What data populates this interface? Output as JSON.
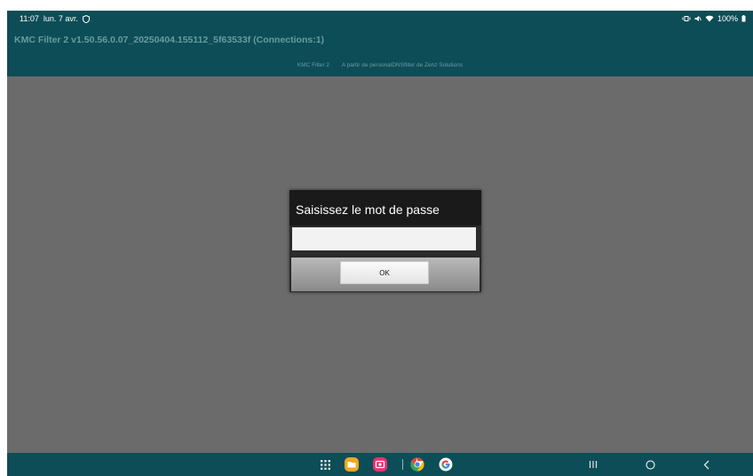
{
  "status_bar": {
    "time": "11:07",
    "date": "lun. 7 avr.",
    "battery": "100%"
  },
  "app_bar": {
    "title": "KMC Filter 2 v1.50.56.0.07_20250404.155112_5f63533f (Connections:1)",
    "subtitle_app": "KMC Filter 2",
    "subtitle_desc": "A partir de personalDNSfilter de Zenz Solutions"
  },
  "dialog": {
    "title": "Saisissez le mot de passe",
    "input_value": "",
    "ok_label": "OK"
  },
  "navbar": {
    "icons": [
      "apps-grid-icon",
      "folder-app-icon",
      "screen-recorder-app-icon",
      "chrome-app-icon",
      "google-app-icon",
      "recents-icon",
      "home-icon",
      "back-icon"
    ]
  },
  "colors": {
    "bar": "#0d4d57",
    "dim_content": "#6b6b6b",
    "dialog_header": "#1a1a1a",
    "title_text": "#6a9aa2"
  }
}
